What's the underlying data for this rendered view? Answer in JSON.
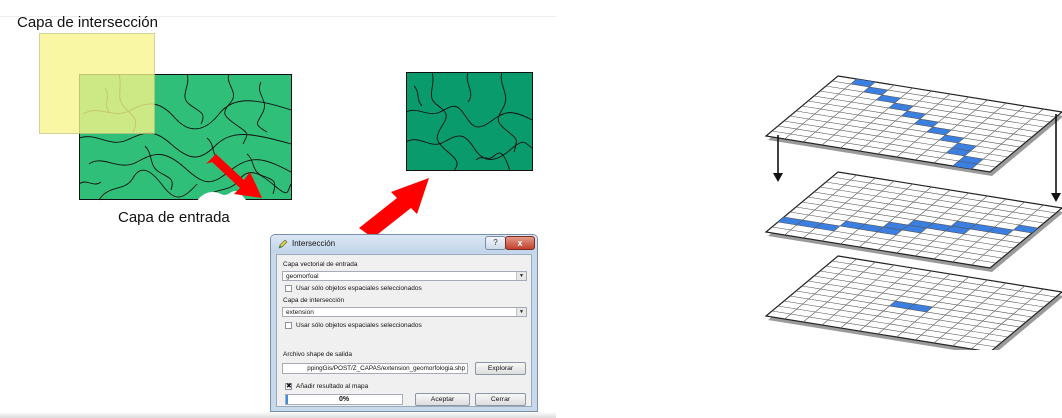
{
  "left": {
    "intersection_caption": "Capa de intersección",
    "input_caption": "Capa de entrada"
  },
  "dialog": {
    "title": "Intersección",
    "help_glyph": "?",
    "close_glyph": "x",
    "input_vector_label": "Capa vectorial de entrada",
    "input_vector_value": "geomorfoal",
    "use_selected_1_label": "Usar sólo objetos espaciales seleccionados",
    "use_selected_1_checked": false,
    "intersection_layer_label": "Capa de intersección",
    "intersection_layer_value": "extension",
    "use_selected_2_label": "Usar sólo objetos espaciales seleccionados",
    "use_selected_2_checked": false,
    "output_label": "Archivo shape de salida",
    "output_value": "ppingGis/POST/Z_CAPAS/extension_geomorfologia.shp",
    "browse_label": "Explorar",
    "add_result_label": "Añadir resultado al mapa",
    "add_result_checked": true,
    "check_glyph": "✖",
    "progress_text": "0%",
    "progress_value": 0,
    "accept_label": "Aceptar",
    "close_label": "Cerrar"
  },
  "colors": {
    "map_green": "#2fbf78",
    "map_dark_green": "#0a9b6c",
    "intersection_yellow": "#f8f58a",
    "arrow_red": "#ff0000",
    "grid_blue": "#3b7fe0"
  }
}
